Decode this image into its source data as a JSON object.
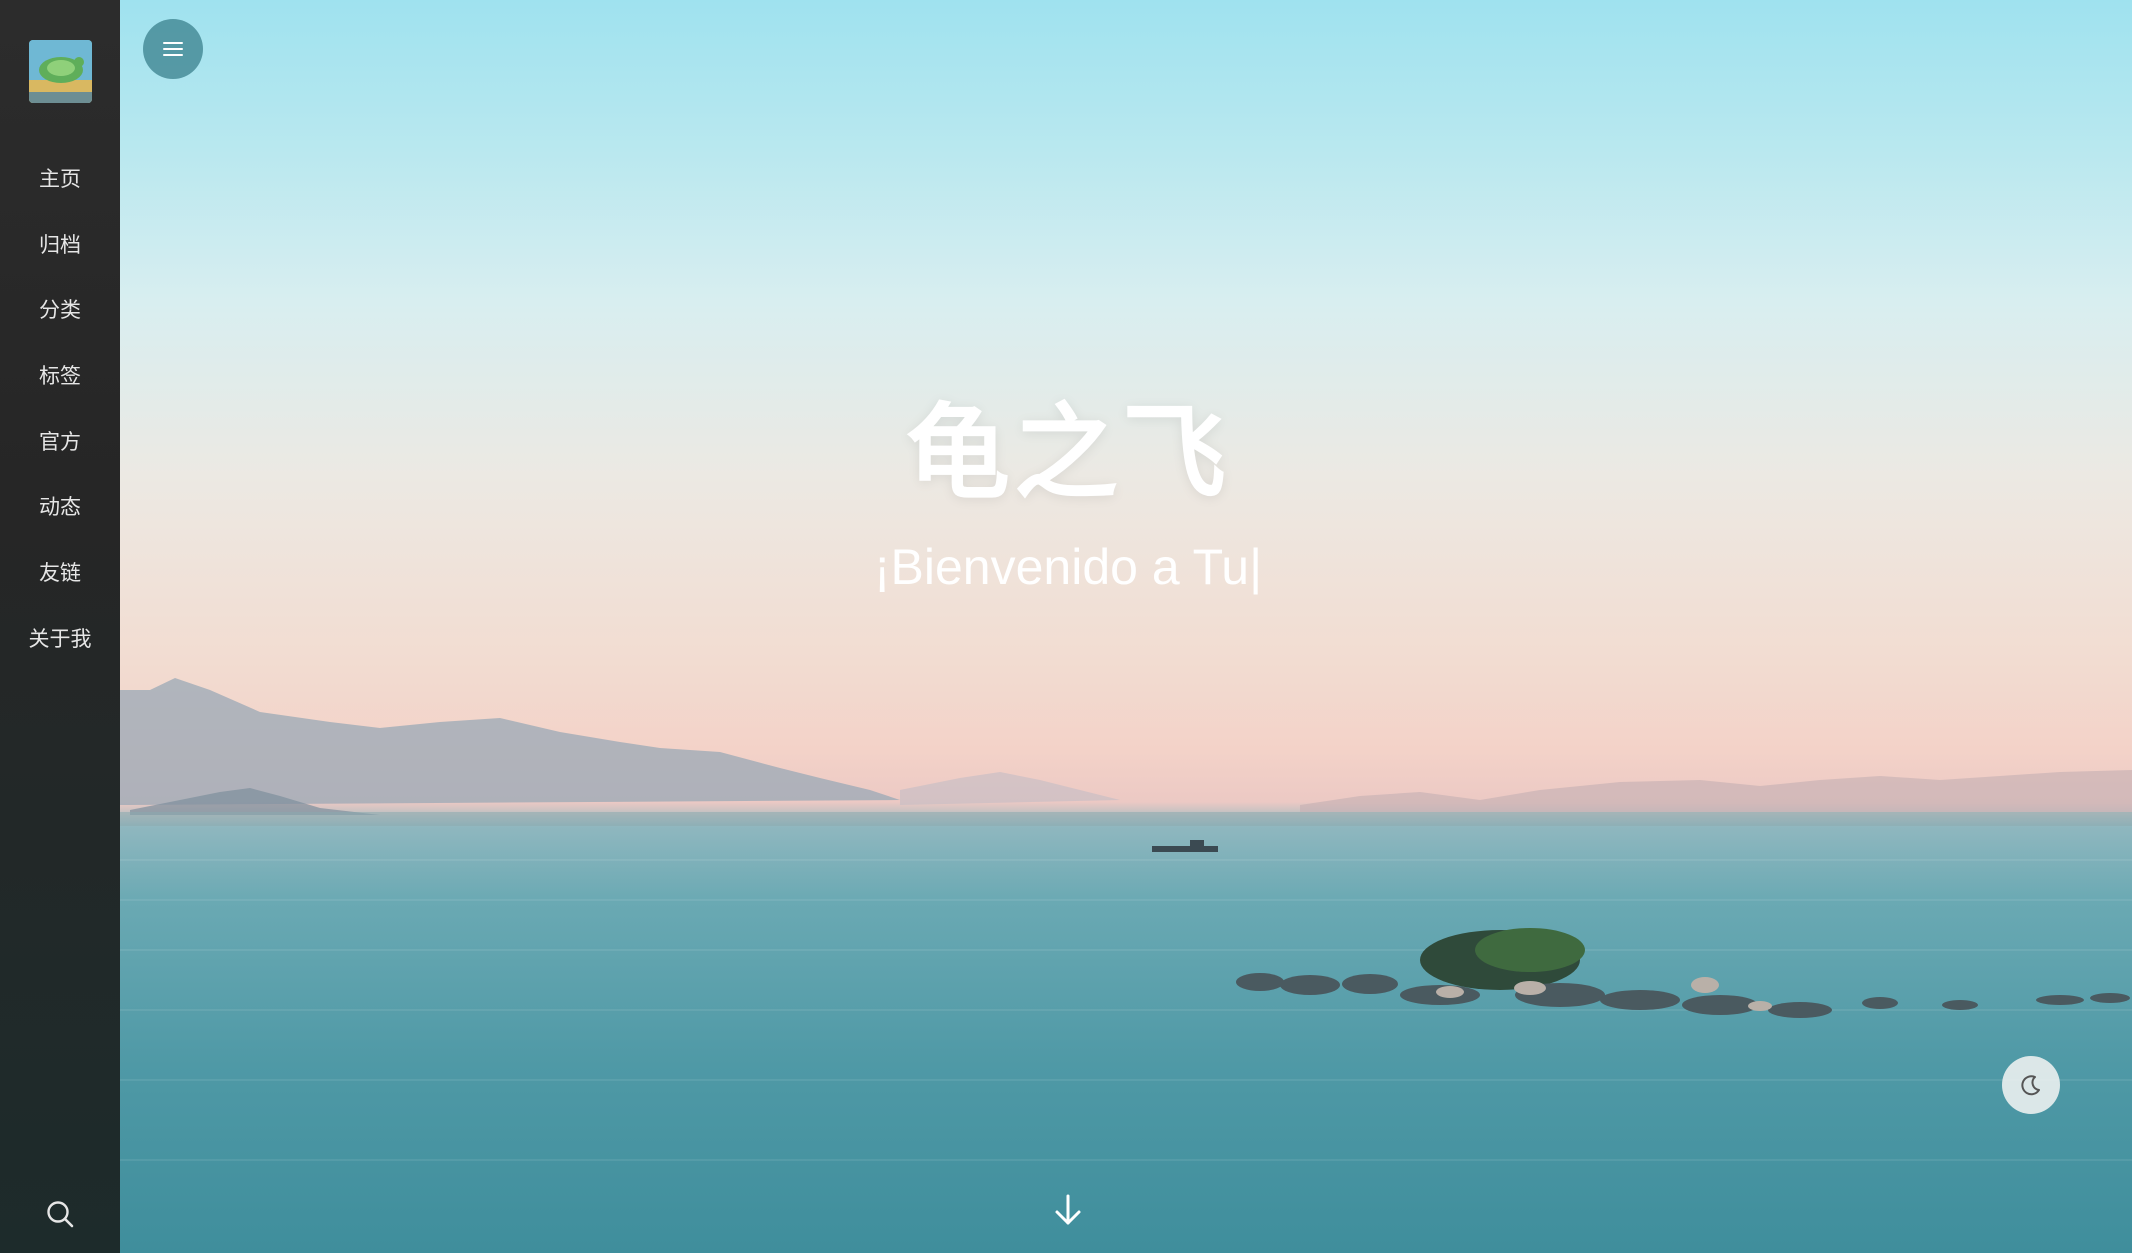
{
  "site": {
    "title": "龟之飞",
    "subtitle": "¡Bienvenido a Tu|"
  },
  "sidebar": {
    "avatar_icon": "avatar-image",
    "items": [
      {
        "label": "主页"
      },
      {
        "label": "归档"
      },
      {
        "label": "分类"
      },
      {
        "label": "标签"
      },
      {
        "label": "官方"
      },
      {
        "label": "动态"
      },
      {
        "label": "友链"
      },
      {
        "label": "关于我"
      }
    ],
    "search_icon": "search-icon"
  },
  "controls": {
    "menu_icon": "menu-icon",
    "dark_mode_icon": "moon-icon",
    "scroll_icon": "arrow-down-icon"
  },
  "colors": {
    "sidebar_bg": "#2c2c2c",
    "toggle_bg": "#468c98",
    "text": "#ffffff"
  }
}
